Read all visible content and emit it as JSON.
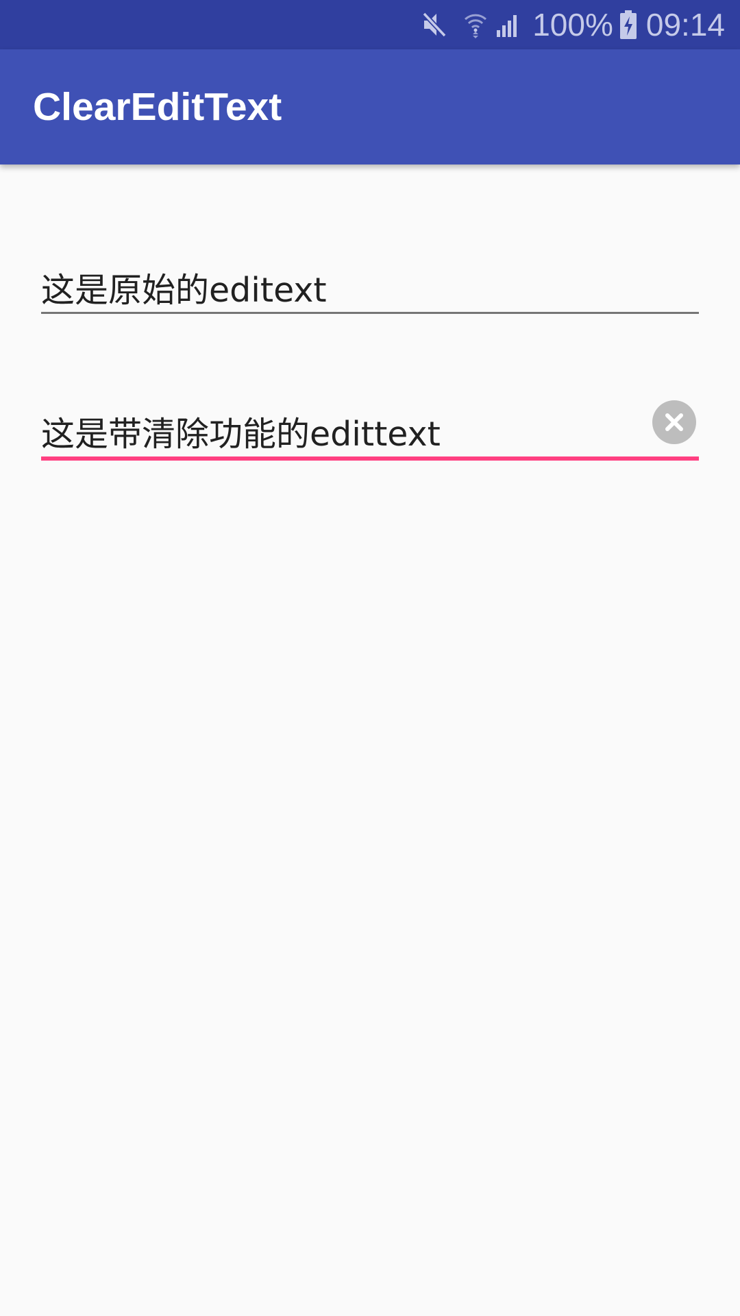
{
  "status_bar": {
    "battery_percent": "100%",
    "time": "09:14",
    "icons": [
      "mute-icon",
      "wifi-icon",
      "signal-icon",
      "battery-charging-icon"
    ],
    "background_color": "#303f9f"
  },
  "app_bar": {
    "title": "ClearEditText",
    "background_color": "#3f51b5"
  },
  "fields": {
    "original": {
      "value": "这是原始的editext",
      "underline_color": "#757575"
    },
    "clearable": {
      "value": "这是带清除功能的edittext",
      "underline_color": "#ff4081",
      "clear_icon": "clear-circle-icon"
    }
  }
}
